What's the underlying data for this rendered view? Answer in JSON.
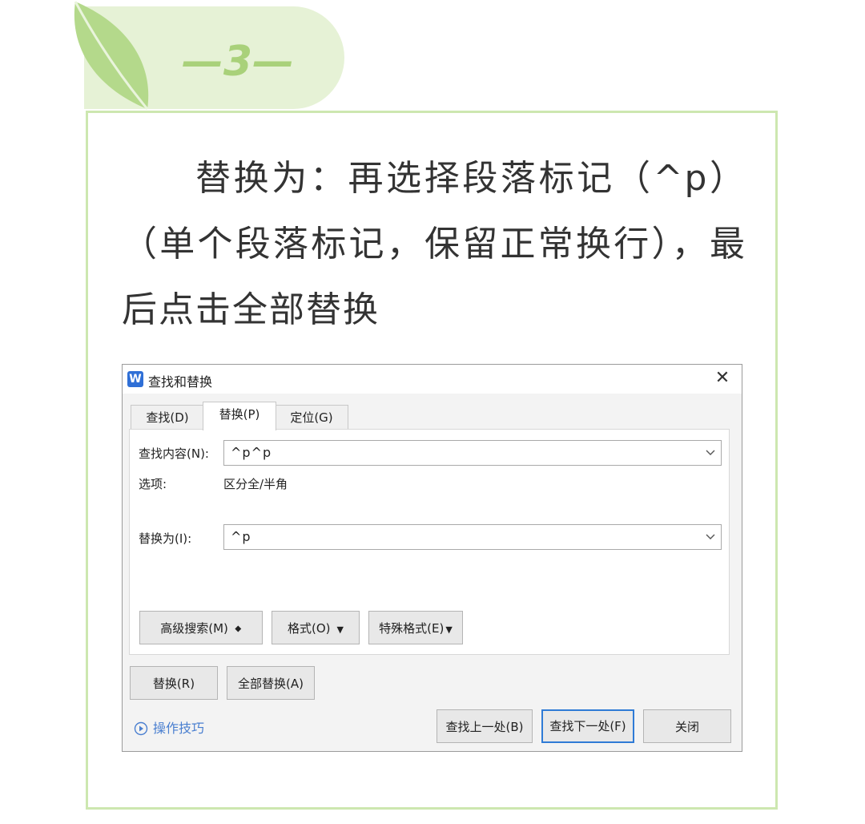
{
  "header": {
    "step_number": "—3—"
  },
  "instruction": {
    "text": "替换为：再选择段落标记（^p）（单个段落标记，保留正常换行），最后点击全部替换"
  },
  "dialog": {
    "app_icon_letter": "W",
    "title": "查找和替换",
    "close_symbol": "✕",
    "tabs": [
      {
        "label": "查找(D)",
        "active": false
      },
      {
        "label": "替换(P)",
        "active": true
      },
      {
        "label": "定位(G)",
        "active": false
      }
    ],
    "find_label": "查找内容(N):",
    "find_value": "^p^p",
    "options_label": "选项:",
    "options_value": "区分全/半角",
    "replace_label": "替换为(I):",
    "replace_value": "^p",
    "advanced_search_label": "高级搜索(M)",
    "advanced_search_caret": "⯁",
    "format_label": "格式(O)",
    "special_format_label": "特殊格式(E)",
    "dropdown_caret": "▼",
    "replace_button": "替换(R)",
    "replace_all_button": "全部替换(A)",
    "tips_label": "操作技巧",
    "find_prev_button": "查找上一处(B)",
    "find_next_button": "查找下一处(F)",
    "close_button": "关闭"
  },
  "colors": {
    "accent_green": "#a9d17a",
    "pale_green": "#e6f2d6",
    "border_green": "#cde7b0",
    "link_blue": "#4a7fd0",
    "focus_blue": "#2f7bd6"
  },
  "icons": [
    "leaf-icon",
    "wps-app-icon",
    "close-icon",
    "chevron-down-icon",
    "play-circle-icon"
  ]
}
